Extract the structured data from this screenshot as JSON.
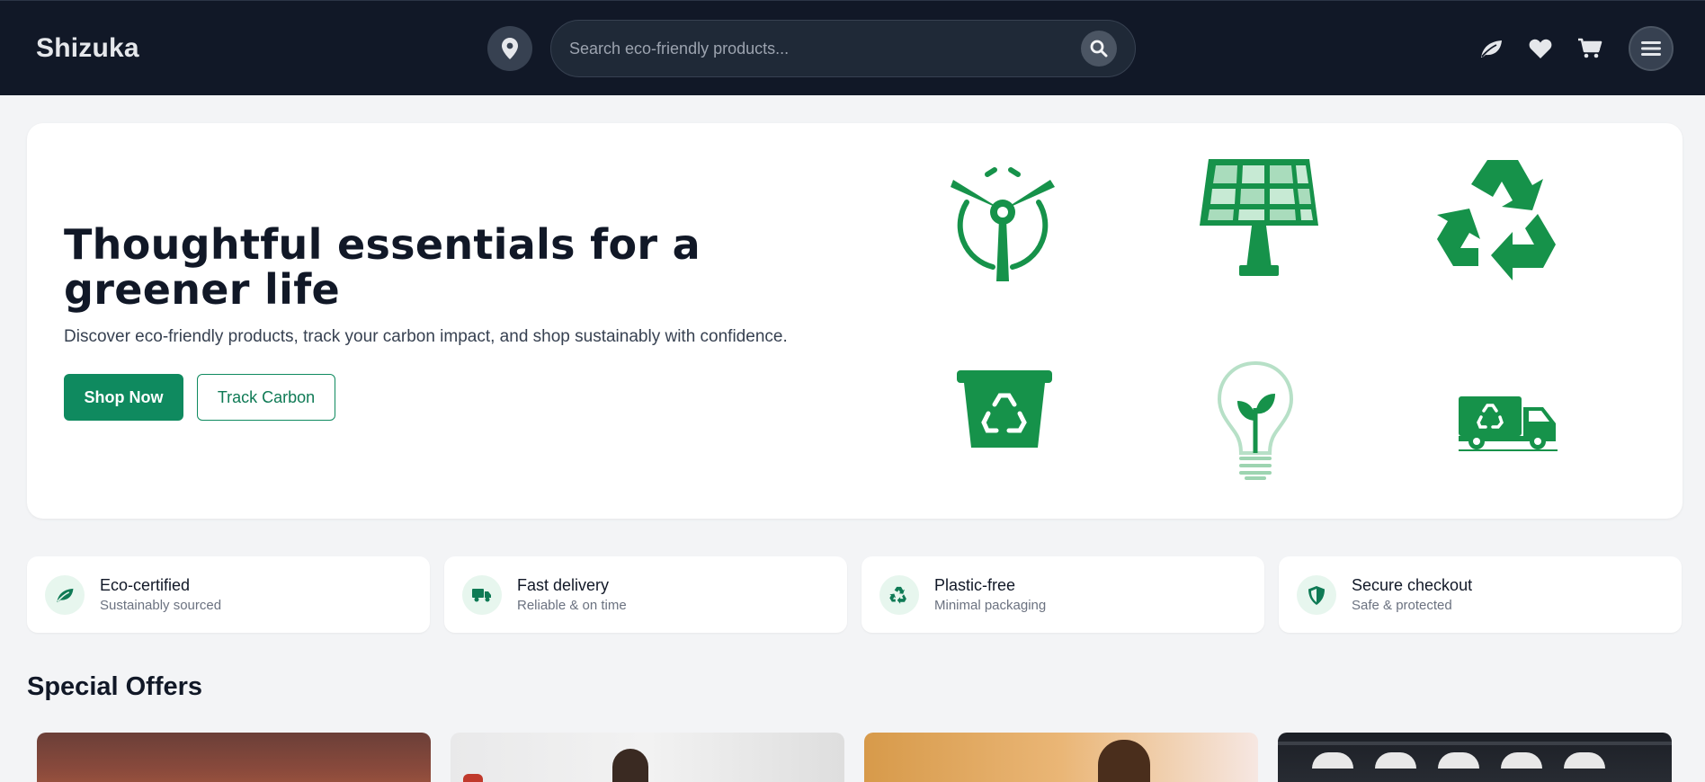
{
  "header": {
    "logo": "Shizuka",
    "search_placeholder": "Search eco-friendly products...",
    "icons": [
      "location-icon",
      "search-icon",
      "leaf-icon",
      "heart-icon",
      "cart-icon",
      "menu-icon"
    ]
  },
  "hero": {
    "title": "Thoughtful essentials for a greener life",
    "subtitle": "Discover eco-friendly products, track your carbon impact, and shop sustainably with confidence.",
    "primary_button": "Shop Now",
    "secondary_button": "Track Carbon",
    "illustrations": [
      "wind-turbine-icon",
      "solar-panel-icon",
      "recycle-icon",
      "recycle-bin-icon",
      "eco-bulb-icon",
      "recycling-truck-icon"
    ]
  },
  "features": [
    {
      "title": "Eco-certified",
      "subtitle": "Sustainably sourced",
      "icon": "leaf-icon"
    },
    {
      "title": "Fast delivery",
      "subtitle": "Reliable & on time",
      "icon": "truck-icon"
    },
    {
      "title": "Plastic-free",
      "subtitle": "Minimal packaging",
      "icon": "recycle-icon"
    },
    {
      "title": "Secure checkout",
      "subtitle": "Safe & protected",
      "icon": "shield-icon"
    }
  ],
  "offers": {
    "title": "Special Offers"
  },
  "colors": {
    "header_bg": "#111827",
    "accent": "#0f8a5f",
    "illustration_green": "#16924a",
    "page_bg": "#f3f4f6"
  }
}
